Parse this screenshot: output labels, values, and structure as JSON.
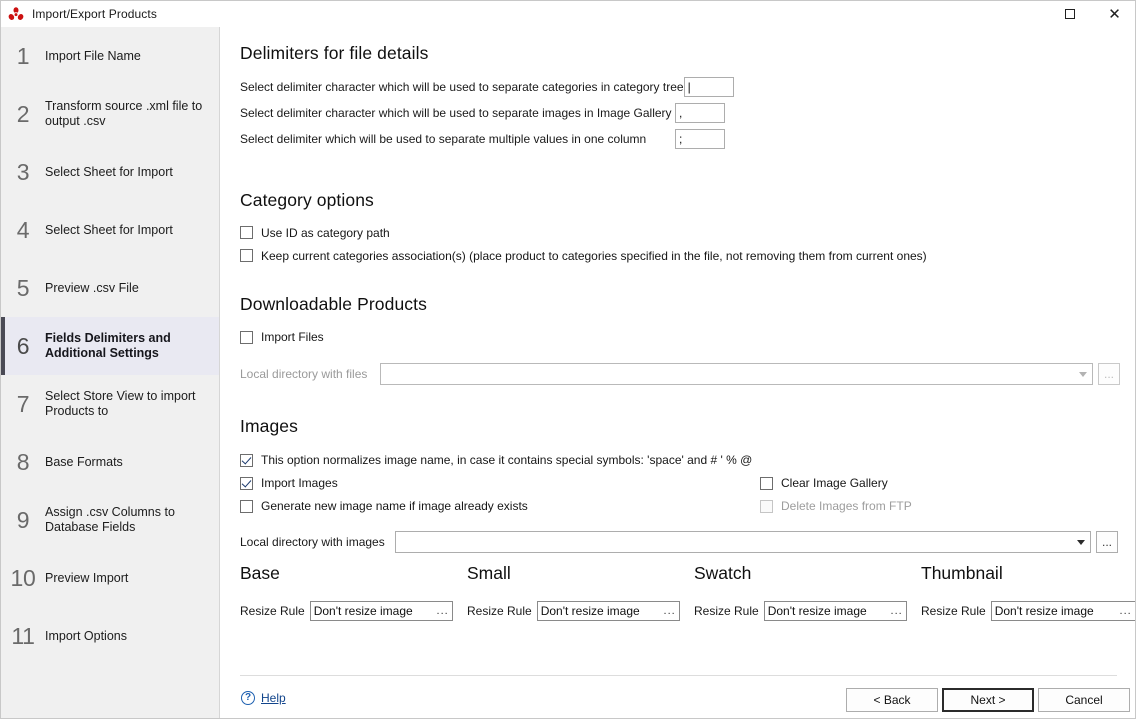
{
  "window": {
    "title": "Import/Export Products",
    "icon": "app-logo-icon",
    "maximize_label": "Maximize",
    "close_label": "Close"
  },
  "sidebar": {
    "steps": [
      {
        "num": "1",
        "label": "Import File Name",
        "active": false
      },
      {
        "num": "2",
        "label": "Transform source .xml file to output .csv",
        "active": false
      },
      {
        "num": "3",
        "label": "Select Sheet for Import",
        "active": false
      },
      {
        "num": "4",
        "label": "Select Sheet for Import",
        "active": false
      },
      {
        "num": "5",
        "label": "Preview .csv File",
        "active": false
      },
      {
        "num": "6",
        "label": "Fields Delimiters and Additional Settings",
        "active": true
      },
      {
        "num": "7",
        "label": "Select Store View to import Products to",
        "active": false
      },
      {
        "num": "8",
        "label": "Base Formats",
        "active": false
      },
      {
        "num": "9",
        "label": "Assign .csv Columns to Database Fields",
        "active": false
      },
      {
        "num": "10",
        "label": "Preview Import",
        "active": false
      },
      {
        "num": "11",
        "label": "Import Options",
        "active": false
      }
    ]
  },
  "delimiters": {
    "heading": "Delimiters for file details",
    "rows": [
      {
        "label": "Select delimiter character which will be used to separate categories in category tree",
        "value": "|"
      },
      {
        "label": "Select delimiter character which will be used to separate images in Image Gallery",
        "value": ","
      },
      {
        "label": "Select delimiter which will be used to separate multiple values in one column",
        "value": ";"
      }
    ]
  },
  "category_options": {
    "heading": "Category options",
    "checkboxes": [
      {
        "label": "Use ID as category path",
        "checked": false,
        "disabled": false
      },
      {
        "label": "Keep current categories association(s) (place product to categories specified in the file, not removing them from current ones)",
        "checked": false,
        "disabled": false
      }
    ]
  },
  "downloadable": {
    "heading": "Downloadable Products",
    "import_files": {
      "label": "Import Files",
      "checked": false,
      "disabled": false
    },
    "directory": {
      "label": "Local directory with files",
      "value": "",
      "disabled": true,
      "browse_label": "..."
    }
  },
  "images": {
    "heading": "Images",
    "normalize": {
      "label": "This option normalizes image name, in case it contains special symbols: 'space' and # ' % @",
      "checked": true,
      "disabled": false
    },
    "import_images": {
      "label": "Import Images",
      "checked": true,
      "disabled": false
    },
    "generate_new_name": {
      "label": "Generate new image name if image already exists",
      "checked": false,
      "disabled": false
    },
    "clear_gallery": {
      "label": "Clear Image Gallery",
      "checked": false,
      "disabled": false
    },
    "delete_from_ftp": {
      "label": "Delete Images from FTP",
      "checked": false,
      "disabled": true
    },
    "directory": {
      "label": "Local directory with images",
      "value": "",
      "disabled": false,
      "browse_label": "..."
    },
    "resize_label": "Resize Rule",
    "resize_dots": "...",
    "columns": [
      {
        "title": "Base",
        "resize_label": "Resize Rule",
        "value": "Don't resize image"
      },
      {
        "title": "Small",
        "resize_label": "Resize Rule",
        "value": "Don't resize image"
      },
      {
        "title": "Swatch",
        "resize_label": "Resize Rule",
        "value": "Don't resize image"
      },
      {
        "title": "Thumbnail",
        "resize_label": "Resize Rule",
        "value": "Don't resize image"
      }
    ]
  },
  "footer": {
    "help": {
      "label": "Help",
      "icon": "question-circle-icon"
    },
    "back": {
      "label": "< Back",
      "mnemonic": "B"
    },
    "next": {
      "label": "Next >",
      "mnemonic": "N",
      "default": true
    },
    "cancel": {
      "label": "Cancel",
      "mnemonic": "C"
    }
  },
  "colors": {
    "sidebar_bg": "#f0f0f0",
    "active_step_bg": "#e9e9f2",
    "active_step_accent": "#4a4a55",
    "link": "#12458c",
    "icon_red": "#cc1111"
  }
}
